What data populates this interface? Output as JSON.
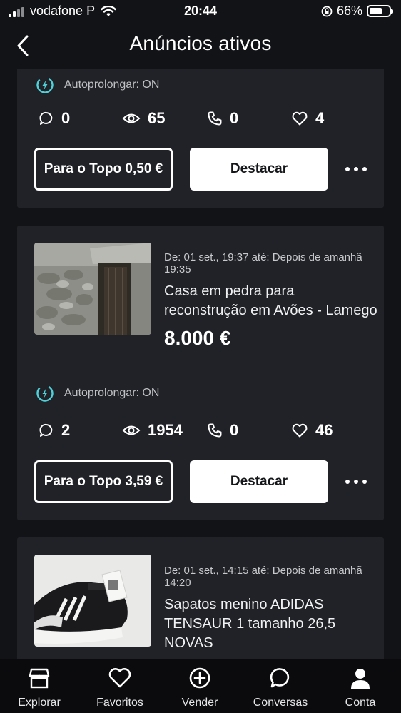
{
  "status_bar": {
    "carrier": "vodafone P",
    "time": "20:44",
    "battery_percent": "66%",
    "battery_level": 0.66
  },
  "header": {
    "title": "Anúncios ativos",
    "back_icon": "chevron-left-icon"
  },
  "colors": {
    "background": "#121316",
    "card": "#202227",
    "autoprolong_icon": "#4fd1d9",
    "primary_button": "#ffffff"
  },
  "listings": [
    {
      "autoprolong": "Autoprolongar: ON",
      "stats": {
        "messages": "0",
        "views": "65",
        "calls": "0",
        "favorites": "4"
      },
      "topo_label": "Para o Topo 0,50 €",
      "destacar_label": "Destacar"
    },
    {
      "date": "De: 01 set., 19:37 até: Depois de amanhã 19:35",
      "title": "Casa em pedra para reconstrução em Avões - Lamego",
      "price": "8.000 €",
      "autoprolong": "Autoprolongar: ON",
      "stats": {
        "messages": "2",
        "views": "1954",
        "calls": "0",
        "favorites": "46"
      },
      "topo_label": "Para o Topo 3,59 €",
      "destacar_label": "Destacar"
    },
    {
      "date": "De: 01 set., 14:15 até: Depois de amanhã 14:20",
      "title": "Sapatos menino ADIDAS TENSAUR 1 tamanho 26,5 NOVAS"
    }
  ],
  "bottom_nav": [
    {
      "label": "Explorar",
      "icon": "store-icon"
    },
    {
      "label": "Favoritos",
      "icon": "heart-icon"
    },
    {
      "label": "Vender",
      "icon": "plus-circle-icon"
    },
    {
      "label": "Conversas",
      "icon": "chat-bubble-icon"
    },
    {
      "label": "Conta",
      "icon": "user-icon"
    }
  ]
}
